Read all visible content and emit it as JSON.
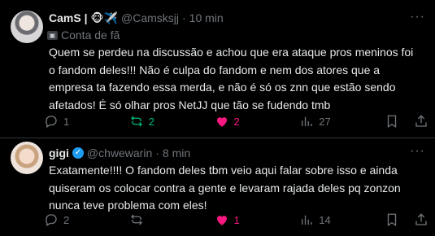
{
  "tweet1": {
    "name": "CamS | 🐵✈️",
    "handle": "@Camsksjj",
    "dot": "·",
    "time": "10 min",
    "fan_label": "Conta de fã",
    "text": "Quem se perdeu na discussão e achou que era ataque pros meninos foi o fandom deles!!! Não é culpa do fandom e nem dos atores que a empresa ta fazendo essa merda, e não é só os znn que estão sendo afetados! É só olhar pros NetJJ que tão se fudendo tmb",
    "replies": "1",
    "reposts": "2",
    "likes": "2",
    "views": "27"
  },
  "tweet2": {
    "name": "gigi",
    "handle": "@chwewarin",
    "dot": "·",
    "time": "8 min",
    "text": "Exatamente!!!! O fandom deles tbm veio aqui falar sobre isso e ainda quiseram os colocar contra a gente e levaram rajada deles pq zonzon nunca teve problema com eles!",
    "replies": "2",
    "reposts": "",
    "likes": "1",
    "views": "14"
  },
  "icons": {
    "reply": "reply-icon",
    "repost": "repost-icon",
    "like": "heart-icon",
    "views": "views-icon",
    "bookmark": "bookmark-icon",
    "share": "share-icon",
    "more": "more-icon"
  },
  "colors": {
    "repost_active": "#00ba7c",
    "like_active": "#f91880",
    "verified": "#1d9bf0",
    "muted": "#71767b"
  }
}
